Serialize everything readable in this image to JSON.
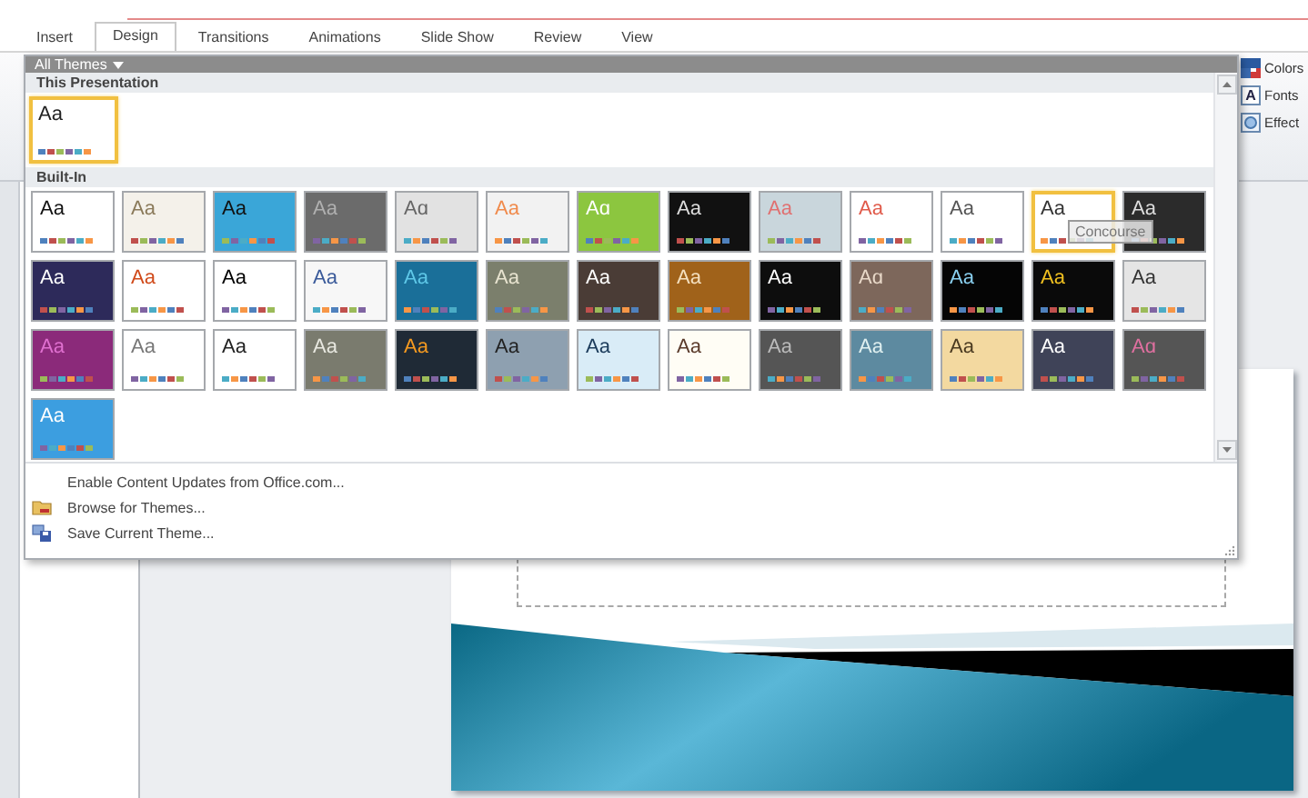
{
  "tabs": [
    {
      "label": "Insert",
      "selected": false
    },
    {
      "label": "Design",
      "selected": true
    },
    {
      "label": "Transitions",
      "selected": false
    },
    {
      "label": "Animations",
      "selected": false
    },
    {
      "label": "Slide Show",
      "selected": false
    },
    {
      "label": "Review",
      "selected": false
    },
    {
      "label": "View",
      "selected": false
    }
  ],
  "ribbon_commands": [
    {
      "kind": "colors",
      "label": "Colors"
    },
    {
      "kind": "fonts",
      "label": "Fonts",
      "glyph": "A"
    },
    {
      "kind": "effects",
      "label": "Effect"
    }
  ],
  "gallery": {
    "title": "All Themes",
    "tooltip": "Concourse",
    "sections": [
      {
        "heading": "This Presentation",
        "themes": [
          {
            "color": "#ffffff",
            "selected": true,
            "sample": {
              "text": "Aa",
              "color": "#222222"
            }
          }
        ]
      },
      {
        "heading": "Built-In",
        "themes": [
          {
            "color": "#ffffff",
            "selected": false,
            "sample": {
              "text": "Aa",
              "color": "#111111"
            }
          },
          {
            "color": "#f4f1ea",
            "selected": false,
            "sample": {
              "text": "Aa",
              "color": "#8a7a5a"
            }
          },
          {
            "color": "#3aa6d8",
            "selected": false,
            "sample": {
              "text": "Aa",
              "color": "#111111"
            }
          },
          {
            "color": "#6b6b6b",
            "selected": false,
            "sample": {
              "text": "Aa",
              "color": "#b0b0b0"
            }
          },
          {
            "color": "#e2e2e2",
            "selected": false,
            "sample": {
              "text": "Aɑ",
              "color": "#666666"
            }
          },
          {
            "color": "#f2f2f2",
            "selected": false,
            "sample": {
              "text": "Aa",
              "color": "#f08a4b"
            }
          },
          {
            "color": "#8cc63f",
            "selected": false,
            "sample": {
              "text": "Aɑ",
              "color": "#ffffff"
            }
          },
          {
            "color": "#111111",
            "selected": false,
            "sample": {
              "text": "Aa",
              "color": "#dddddd"
            }
          },
          {
            "color": "#c9d6dc",
            "selected": false,
            "sample": {
              "text": "Aa",
              "color": "#e07070"
            }
          },
          {
            "color": "#ffffff",
            "selected": false,
            "sample": {
              "text": "Aa",
              "color": "#e05a4a"
            }
          },
          {
            "color": "#ffffff",
            "selected": false,
            "sample": {
              "text": "Aa",
              "color": "#555555"
            }
          },
          {
            "color": "#ffffff",
            "selected": true,
            "sample": {
              "text": "Aa",
              "color": "#333333"
            }
          },
          {
            "color": "#2b2b2b",
            "selected": false,
            "sample": {
              "text": "Aa",
              "color": "#dddddd"
            }
          },
          {
            "color": "#2d2a5a",
            "selected": false,
            "sample": {
              "text": "Aa",
              "color": "#ffffff"
            }
          },
          {
            "color": "#ffffff",
            "selected": false,
            "sample": {
              "text": "Aa",
              "color": "#d04a1a"
            }
          },
          {
            "color": "#ffffff",
            "selected": false,
            "sample": {
              "text": "Aa",
              "color": "#000000"
            }
          },
          {
            "color": "#f7f7f7",
            "selected": false,
            "sample": {
              "text": "Aa",
              "color": "#3a5a9a"
            }
          },
          {
            "color": "#1a6f99",
            "selected": false,
            "sample": {
              "text": "Aa",
              "color": "#5fc8e8"
            }
          },
          {
            "color": "#7b7f6c",
            "selected": false,
            "sample": {
              "text": "Aa",
              "color": "#e8e4d0"
            }
          },
          {
            "color": "#4a3c36",
            "selected": false,
            "sample": {
              "text": "Aa",
              "color": "#ffffff"
            }
          },
          {
            "color": "#a0621a",
            "selected": false,
            "sample": {
              "text": "Aa",
              "color": "#f4e0c0"
            }
          },
          {
            "color": "#0d0d0d",
            "selected": false,
            "sample": {
              "text": "Aa",
              "color": "#ffffff"
            }
          },
          {
            "color": "#7d675b",
            "selected": false,
            "sample": {
              "text": "Aɑ",
              "color": "#e8d8c8"
            }
          },
          {
            "color": "#050505",
            "selected": false,
            "sample": {
              "text": "Aa",
              "color": "#8ad0f0"
            }
          },
          {
            "color": "#0a0a0a",
            "selected": false,
            "sample": {
              "text": "Aa",
              "color": "#f0c020"
            }
          },
          {
            "color": "#e5e5e5",
            "selected": false,
            "sample": {
              "text": "Aa",
              "color": "#333333"
            }
          },
          {
            "color": "#8b2a7a",
            "selected": false,
            "sample": {
              "text": "Aa",
              "color": "#e070d0"
            }
          },
          {
            "color": "#ffffff",
            "selected": false,
            "sample": {
              "text": "Aa",
              "color": "#777777"
            }
          },
          {
            "color": "#ffffff",
            "selected": false,
            "sample": {
              "text": "Aa",
              "color": "#222222"
            }
          },
          {
            "color": "#7a7b6e",
            "selected": false,
            "sample": {
              "text": "Aa",
              "color": "#e8e8e0"
            }
          },
          {
            "color": "#1f2a36",
            "selected": false,
            "sample": {
              "text": "Aa",
              "color": "#f59a20"
            }
          },
          {
            "color": "#8ea0b0",
            "selected": false,
            "sample": {
              "text": "Aa",
              "color": "#222222"
            }
          },
          {
            "color": "#d9ecf7",
            "selected": false,
            "sample": {
              "text": "Aa",
              "color": "#1a3a5a"
            }
          },
          {
            "color": "#fffdf5",
            "selected": false,
            "sample": {
              "text": "Aa",
              "color": "#5a3a2a"
            }
          },
          {
            "color": "#555555",
            "selected": false,
            "sample": {
              "text": "Aa",
              "color": "#bbbbbb"
            }
          },
          {
            "color": "#5d8aa0",
            "selected": false,
            "sample": {
              "text": "Aa",
              "color": "#e0f0f0"
            }
          },
          {
            "color": "#f3d9a0",
            "selected": false,
            "sample": {
              "text": "Aa",
              "color": "#4a3a20"
            }
          },
          {
            "color": "#3f4358",
            "selected": false,
            "sample": {
              "text": "Aa",
              "color": "#ffffff"
            }
          },
          {
            "color": "#555555",
            "selected": false,
            "sample": {
              "text": "Aɑ",
              "color": "#e070a0"
            }
          },
          {
            "color": "#3c9ee0",
            "selected": false,
            "sample": {
              "text": "Aa",
              "color": "#ffffff"
            }
          }
        ]
      }
    ],
    "menu": [
      {
        "kind": "plain",
        "label": "Enable Content Updates from Office.com..."
      },
      {
        "kind": "browse",
        "label": "Browse for Themes..."
      },
      {
        "kind": "save",
        "label": "Save Current Theme..."
      }
    ]
  }
}
